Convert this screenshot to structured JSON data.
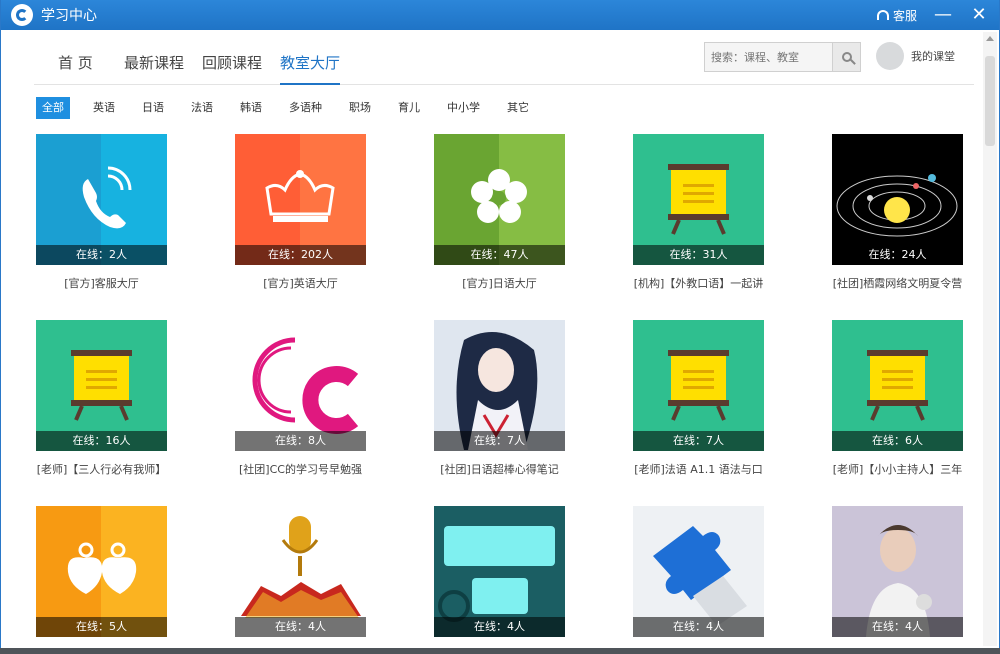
{
  "window": {
    "title": "学习中心",
    "service_label": "客服",
    "minimize_label": "—",
    "close_label": "✕"
  },
  "tabs": [
    {
      "label": "首 页",
      "active": false
    },
    {
      "label": "最新课程",
      "active": false
    },
    {
      "label": "回顾课程",
      "active": false
    },
    {
      "label": "教室大厅",
      "active": true
    }
  ],
  "search": {
    "placeholder": "搜索：课程、教室"
  },
  "user": {
    "my_class_label": "我的课堂"
  },
  "categories": [
    "全部",
    "英语",
    "日语",
    "法语",
    "韩语",
    "多语种",
    "职场",
    "育儿",
    "中小学",
    "其它"
  ],
  "rooms": [
    {
      "online": "在线：2人",
      "name": "[官方]客服大厅",
      "icon": "phone-icon",
      "color": "#1aa5d6"
    },
    {
      "online": "在线：202人",
      "name": "[官方]英语大厅",
      "icon": "crown-icon",
      "color": "#ff6b3d"
    },
    {
      "online": "在线：47人",
      "name": "[官方]日语大厅",
      "icon": "sakura-icon",
      "color": "#7bb43a"
    },
    {
      "online": "在线：31人",
      "name": "[机构]【外教口语】一起讲",
      "icon": "easel-icon",
      "color": "#2fbf8f"
    },
    {
      "online": "在线：24人",
      "name": "[社团]栖霞网络文明夏令营",
      "icon": "solar-system-image",
      "color": "#000000"
    },
    {
      "online": "在线：16人",
      "name": "[老师]【三人行必有我师】",
      "icon": "easel-icon",
      "color": "#2fbf8f"
    },
    {
      "online": "在线：8人",
      "name": "[社团]CC的学习号早勉强",
      "icon": "cc-logo-image",
      "color": "#ffffff"
    },
    {
      "online": "在线：7人",
      "name": "[社团]日语超棒心得笔记",
      "icon": "anime-girl-image",
      "color": "#d6dfe9"
    },
    {
      "online": "在线：7人",
      "name": "[老师]法语 A1.1 语法与口",
      "icon": "easel-icon",
      "color": "#2fbf8f"
    },
    {
      "online": "在线：6人",
      "name": "[老师]【小小主持人】三年",
      "icon": "easel-icon",
      "color": "#2fbf8f"
    },
    {
      "online": "在线：5人",
      "name": "",
      "icon": "hearts-icon",
      "color": "#f7a21b"
    },
    {
      "online": "在线：4人",
      "name": "",
      "icon": "microphone-image",
      "color": "#ffffff"
    },
    {
      "online": "在线：4人",
      "name": "",
      "icon": "babe-logo-image",
      "color": "#1b6f73"
    },
    {
      "online": "在线：4人",
      "name": "",
      "icon": "puzzle-image",
      "color": "#e9eef3"
    },
    {
      "online": "在线：4人",
      "name": "",
      "icon": "portrait-image",
      "color": "#c9c3d6"
    }
  ]
}
